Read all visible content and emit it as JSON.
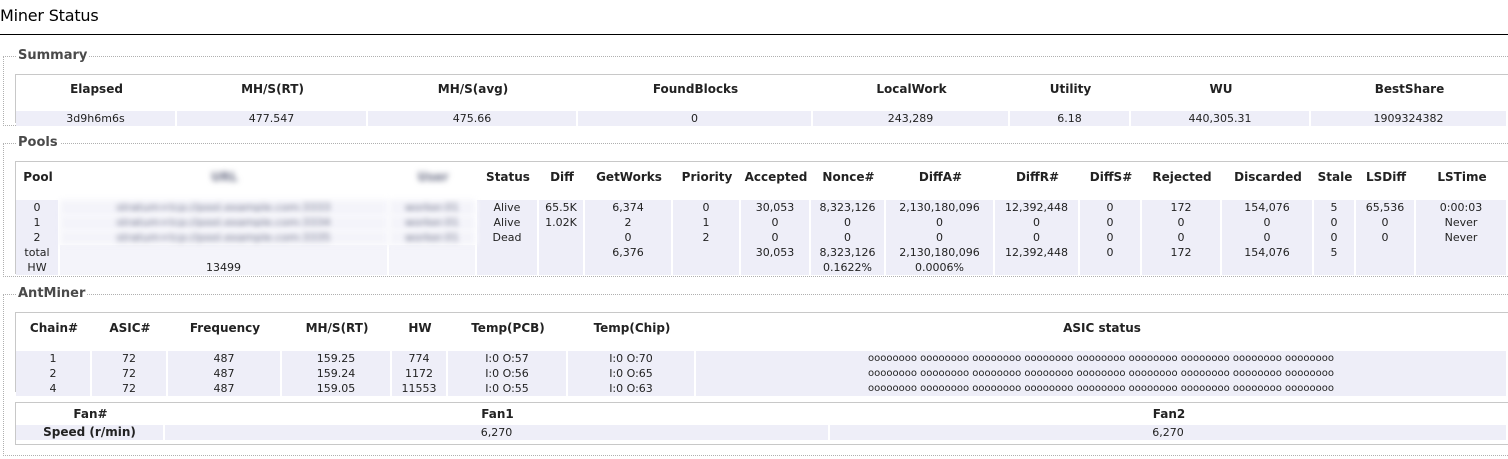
{
  "page_title": "Miner Status",
  "summary": {
    "legend": "Summary",
    "headers": [
      "Elapsed",
      "MH/S(RT)",
      "MH/S(avg)",
      "FoundBlocks",
      "LocalWork",
      "Utility",
      "WU",
      "BestShare"
    ],
    "values": [
      "3d9h6m6s",
      "477.547",
      "475.66",
      "0",
      "243,289",
      "6.18",
      "440,305.31",
      "1909324382"
    ]
  },
  "pools": {
    "legend": "Pools",
    "headers": [
      "Pool",
      "URL",
      "User",
      "Status",
      "Diff",
      "GetWorks",
      "Priority",
      "Accepted",
      "Nonce#",
      "DiffA#",
      "DiffR#",
      "DiffS#",
      "Rejected",
      "Discarded",
      "Stale",
      "LSDiff",
      "LSTime"
    ],
    "rows": [
      [
        "0",
        "stratum+tcp://pool.example.com:3333",
        "worker.01",
        "Alive",
        "65.5K",
        "6,374",
        "0",
        "30,053",
        "8,323,126",
        "2,130,180,096",
        "12,392,448",
        "0",
        "172",
        "154,076",
        "5",
        "65,536",
        "0:00:03"
      ],
      [
        "1",
        "stratum+tcp://pool.example.com:3334",
        "worker.01",
        "Alive",
        "1.02K",
        "2",
        "1",
        "0",
        "0",
        "0",
        "0",
        "0",
        "0",
        "0",
        "0",
        "0",
        "Never"
      ],
      [
        "2",
        "stratum+tcp://pool.example.com:3335",
        "worker.01",
        "Dead",
        "",
        "0",
        "2",
        "0",
        "0",
        "0",
        "0",
        "0",
        "0",
        "0",
        "0",
        "0",
        "Never"
      ],
      [
        "total",
        "",
        "",
        "",
        "",
        "6,376",
        "",
        "30,053",
        "8,323,126",
        "2,130,180,096",
        "12,392,448",
        "0",
        "172",
        "154,076",
        "5",
        "",
        ""
      ],
      [
        "HW",
        "13499",
        "",
        "",
        "",
        "",
        "",
        "",
        "0.1622%",
        "0.0006%",
        "",
        "",
        "",
        "",
        "",
        "",
        ""
      ]
    ]
  },
  "antminer": {
    "legend": "AntMiner",
    "headers": [
      "Chain#",
      "ASIC#",
      "Frequency",
      "MH/S(RT)",
      "HW",
      "Temp(PCB)",
      "Temp(Chip)",
      "ASIC status"
    ],
    "rows": [
      [
        "1",
        "72",
        "487",
        "159.25",
        "774",
        "I:0 O:57",
        "I:0 O:70",
        "oooooooo oooooooo oooooooo oooooooo oooooooo oooooooo oooooooo oooooooo oooooooo"
      ],
      [
        "2",
        "72",
        "487",
        "159.24",
        "1172",
        "I:0 O:56",
        "I:0 O:65",
        "oooooooo oooooooo oooooooo oooooooo oooooooo oooooooo oooooooo oooooooo oooooooo"
      ],
      [
        "4",
        "72",
        "487",
        "159.05",
        "11553",
        "I:0 O:55",
        "I:0 O:63",
        "oooooooo oooooooo oooooooo oooooooo oooooooo oooooooo oooooooo oooooooo oooooooo"
      ]
    ]
  },
  "fans": {
    "headers": [
      "Fan#",
      "Fan1",
      "Fan2"
    ],
    "row_label": "Speed (r/min)",
    "values": [
      "6,270",
      "6,270"
    ]
  }
}
